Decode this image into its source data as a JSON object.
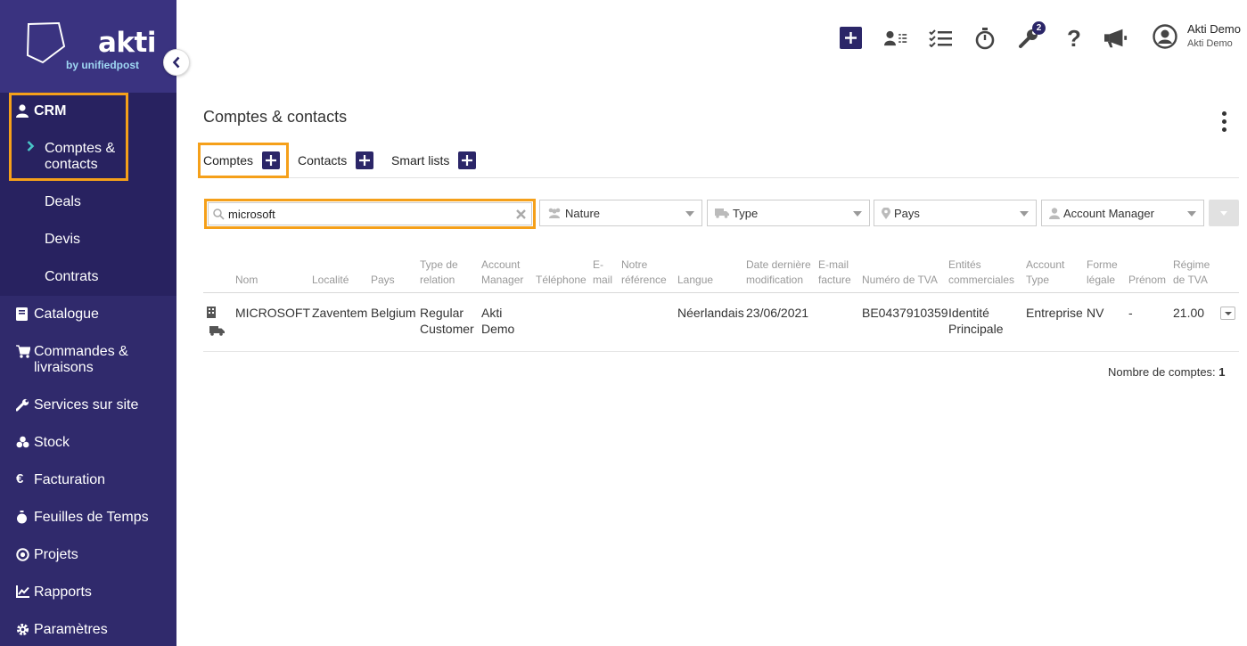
{
  "app": {
    "brand": "akti",
    "brand_sub": "by unifiedpost"
  },
  "sidebar": {
    "crm_label": "CRM",
    "crm_items": [
      "Comptes & contacts",
      "Deals",
      "Devis",
      "Contrats"
    ],
    "items": [
      {
        "label": "Catalogue",
        "icon": "book-icon"
      },
      {
        "label": "Commandes & livraisons",
        "icon": "cart-icon"
      },
      {
        "label": "Services sur site",
        "icon": "wrench-icon"
      },
      {
        "label": "Stock",
        "icon": "boxes-icon"
      },
      {
        "label": "Facturation",
        "icon": "euro-icon"
      },
      {
        "label": "Feuilles de Temps",
        "icon": "stopwatch-icon"
      },
      {
        "label": "Projets",
        "icon": "target-icon"
      },
      {
        "label": "Rapports",
        "icon": "chart-icon"
      },
      {
        "label": "Paramètres",
        "icon": "gear-icon"
      }
    ]
  },
  "topbar": {
    "notification_count": "2",
    "user_name": "Akti Demo",
    "user_company": "Akti Demo"
  },
  "page": {
    "title": "Comptes & contacts",
    "tabs": [
      "Comptes",
      "Contacts",
      "Smart lists"
    ]
  },
  "filters": {
    "search_value": "microsoft",
    "nature": "Nature",
    "type": "Type",
    "pays": "Pays",
    "account_manager": "Account Manager"
  },
  "table": {
    "headers": {
      "nom": "Nom",
      "localite": "Localité",
      "pays": "Pays",
      "type_relation": "Type de relation",
      "account_manager": "Account Manager",
      "telephone": "Téléphone",
      "email": "E-mail",
      "notre_reference": "Notre référence",
      "langue": "Langue",
      "date_modif": "Date dernière modification",
      "email_facture": "E-mail facture",
      "tva": "Numéro de TVA",
      "entites": "Entités commerciales",
      "account_type": "Account Type",
      "forme": "Forme légale",
      "prenom": "Prénom",
      "regime": "Régime de TVA"
    },
    "rows": [
      {
        "nom": "MICROSOFT",
        "localite": "Zaventem",
        "pays": "Belgium",
        "type_relation": "Regular Customer",
        "account_manager": "Akti Demo",
        "langue": "Néerlandais",
        "date_modif": "23/06/2021",
        "tva": "BE0437910359",
        "entites": "Identité Principale",
        "account_type": "Entreprise",
        "forme": "NV",
        "prenom": "-",
        "regime": "21.00"
      }
    ],
    "count_label": "Nombre de comptes:",
    "count": "1"
  },
  "colors": {
    "sidebar": "#302a6c",
    "sidebar_active": "#282260",
    "accent": "#2b2668",
    "highlight": "#f5a01a",
    "chevron": "#49c6c8"
  }
}
